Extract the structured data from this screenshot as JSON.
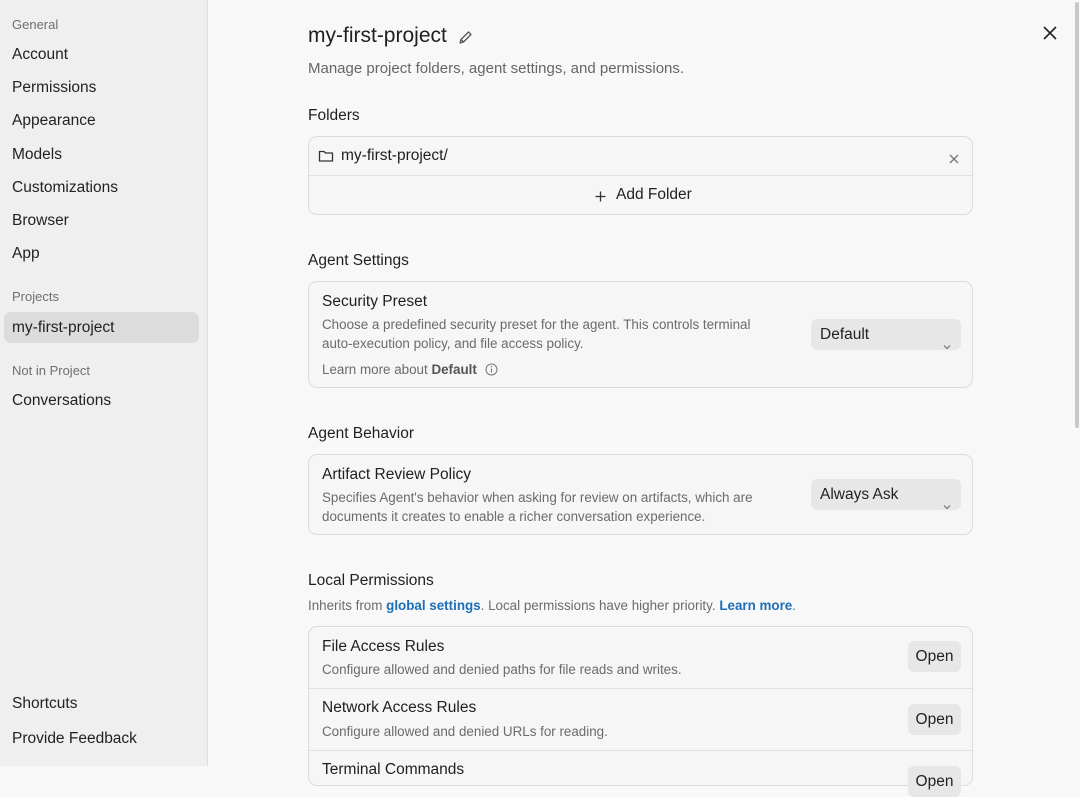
{
  "sidebar": {
    "general_label": "General",
    "general_items": [
      "Account",
      "Permissions",
      "Appearance",
      "Models",
      "Customizations",
      "Browser",
      "App"
    ],
    "projects_label": "Projects",
    "project_item": "my-first-project",
    "not_in_project_label": "Not in Project",
    "conversations": "Conversations",
    "shortcuts": "Shortcuts",
    "feedback": "Provide Feedback"
  },
  "header": {
    "title": "my-first-project",
    "subtitle": "Manage project folders, agent settings, and permissions."
  },
  "folders": {
    "heading": "Folders",
    "folder_name": "my-first-project/",
    "add_label": "Add Folder"
  },
  "agent_settings": {
    "heading": "Agent Settings",
    "title": "Security Preset",
    "desc_line1": "Choose a predefined security preset for the agent. This controls terminal",
    "desc_line2": "auto-execution policy, and file access policy.",
    "learn_prefix": "Learn more about ",
    "learn_bold": "Default",
    "select_value": "Default"
  },
  "agent_behavior": {
    "heading": "Agent Behavior",
    "title": "Artifact Review Policy",
    "desc_line1": "Specifies Agent's behavior when asking for review on artifacts, which are",
    "desc_line2": "documents it creates to enable a richer conversation experience.",
    "select_value": "Always Ask"
  },
  "local_permissions": {
    "heading": "Local Permissions",
    "inherit_prefix": "Inherits from ",
    "global_link": "global settings",
    "inherit_mid": ". Local permissions have higher priority. ",
    "learn_link": "Learn more",
    "inherit_suffix": ".",
    "rows": [
      {
        "title": "File Access Rules",
        "desc": "Configure allowed and denied paths for file reads and writes.",
        "button": "Open"
      },
      {
        "title": "Network Access Rules",
        "desc": "Configure allowed and denied URLs for reading.",
        "button": "Open"
      },
      {
        "title": "Terminal Commands",
        "desc": "",
        "button": "Open"
      }
    ]
  },
  "colors": {
    "link": "#1d6fb8",
    "sidebar_bg": "#efefef",
    "main_bg": "#f8f8f8"
  }
}
